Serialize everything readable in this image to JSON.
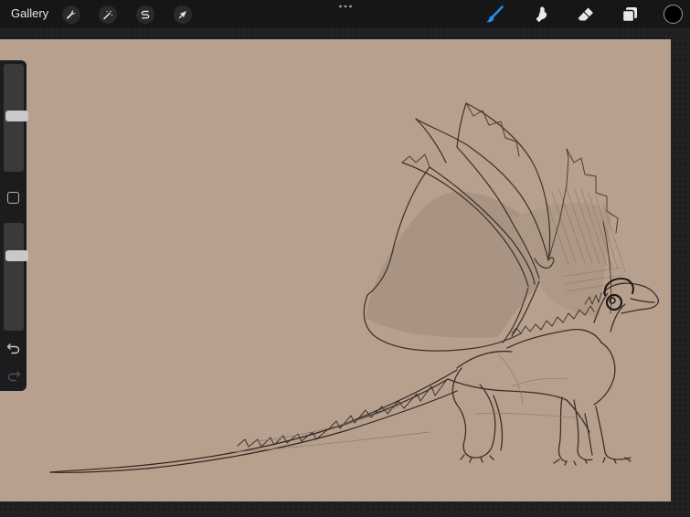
{
  "topbar": {
    "gallery_label": "Gallery",
    "left_tools": [
      {
        "name": "actions",
        "icon": "wrench-icon"
      },
      {
        "name": "adjustments",
        "icon": "magic-wand-icon"
      },
      {
        "name": "selection",
        "icon": "selection-s-icon"
      },
      {
        "name": "transform",
        "icon": "arrow-cursor-icon"
      }
    ],
    "more_icon": "ellipsis-icon",
    "right_tools": [
      {
        "name": "brush",
        "icon": "brush-icon",
        "active": true,
        "color": "#1f8ef1"
      },
      {
        "name": "smudge",
        "icon": "smudge-finger-icon",
        "active": false
      },
      {
        "name": "eraser",
        "icon": "eraser-icon",
        "active": false
      },
      {
        "name": "layers",
        "icon": "layers-icon",
        "active": false
      }
    ],
    "current_color": "#000000"
  },
  "sidebar": {
    "brush_size_level": 0.52,
    "opacity_level": 0.72,
    "modify_icon": "square-icon",
    "undo_icon": "undo-icon",
    "redo_icon": "redo-icon"
  },
  "canvas": {
    "background_color": "#b8a08e",
    "subject": "dragon-sketch"
  }
}
